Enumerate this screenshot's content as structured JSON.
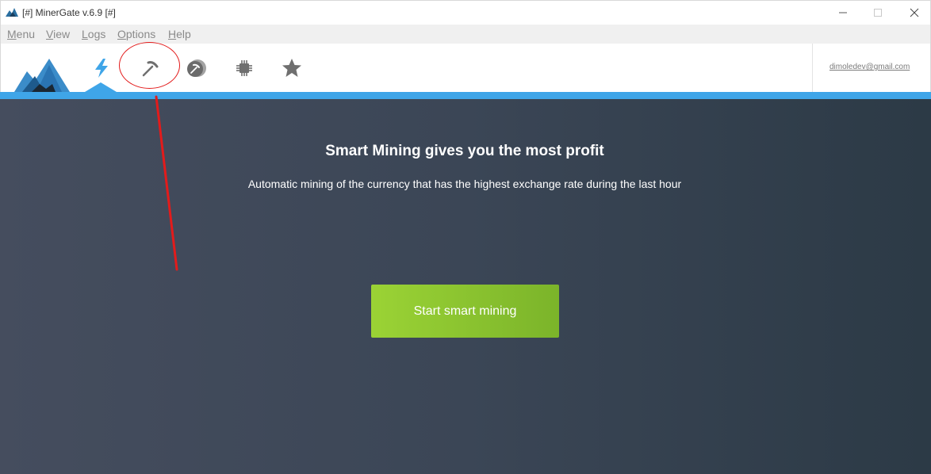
{
  "window": {
    "title": "[#] MinerGate v.6.9 [#]",
    "buttons": [
      "minimize",
      "maximize",
      "close"
    ]
  },
  "menu": {
    "items": [
      {
        "label": "Menu",
        "mnemonic": "M"
      },
      {
        "label": "View",
        "mnemonic": "V"
      },
      {
        "label": "Logs",
        "mnemonic": "L"
      },
      {
        "label": "Options",
        "mnemonic": "O"
      },
      {
        "label": "Help",
        "mnemonic": "H"
      }
    ]
  },
  "toolbar": {
    "logo": "minergate-mountain-logo",
    "tabs": [
      {
        "id": "smart-mining",
        "icon": "lightning-icon",
        "active": true
      },
      {
        "id": "manual-mining",
        "icon": "pickaxe-hammer-icon",
        "active": false
      },
      {
        "id": "mining-pool",
        "icon": "pickaxe-coin-icon",
        "active": false
      },
      {
        "id": "hardware",
        "icon": "chip-icon",
        "active": false
      },
      {
        "id": "favorites",
        "icon": "star-icon",
        "active": false
      }
    ],
    "email": "dimoledev@gmail.com"
  },
  "main": {
    "headline": "Smart Mining gives you the most profit",
    "subline": "Automatic mining of the currency that has the highest exchange rate during the last hour",
    "start_button": "Start smart mining"
  },
  "colors": {
    "accent_blue": "#3fa5e8",
    "start_green": "#8cc430",
    "panel_dark": "#3b4656",
    "annotation_red": "#e31b1b"
  }
}
